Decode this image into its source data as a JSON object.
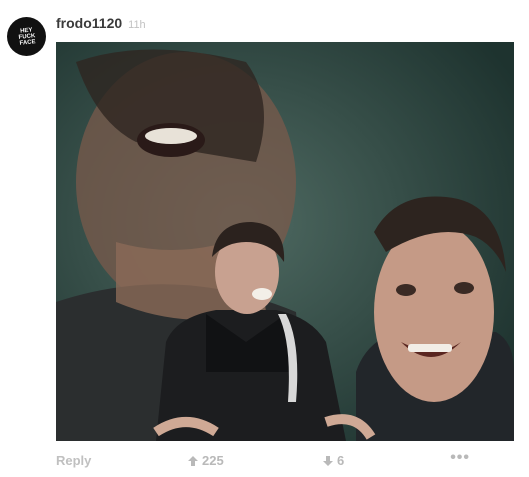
{
  "post": {
    "avatar_text": "HEY\nFUCK\nFACE",
    "username": "frodo1120",
    "time": "11h"
  },
  "actions": {
    "reply": "Reply",
    "upvotes": "225",
    "downvotes": "6",
    "more": "•••"
  },
  "colors": {
    "background": "#ffffff",
    "image_bg": "#29433e",
    "muted_text": "#b9b9b9"
  }
}
